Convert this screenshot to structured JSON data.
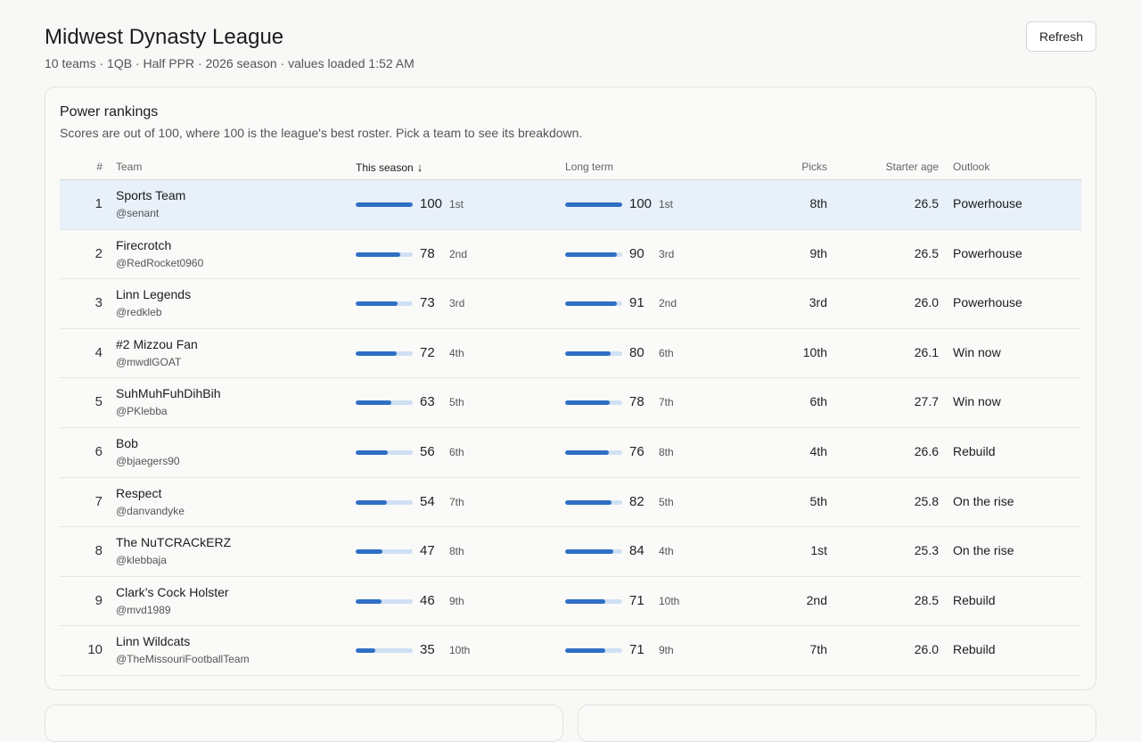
{
  "header": {
    "title": "Midwest Dynasty League",
    "subtitle": "10 teams · 1QB · Half PPR · 2026 season · values loaded 1:52 AM",
    "refresh_label": "Refresh"
  },
  "rankings": {
    "title": "Power rankings",
    "description": "Scores are out of 100, where 100 is the league's best roster. Pick a team to see its breakdown.",
    "columns": {
      "rank": "#",
      "team": "Team",
      "this_season": "This season",
      "sort_arrow": "↓",
      "long_term": "Long term",
      "picks": "Picks",
      "starter_age": "Starter age",
      "outlook": "Outlook"
    },
    "selected_index": 0,
    "rows": [
      {
        "rank": "1",
        "name": "Sports Team",
        "handle": "@senant",
        "season_score": 100,
        "season_place": "1st",
        "long_score": 100,
        "long_place": "1st",
        "picks": "8th",
        "age": "26.5",
        "outlook": "Powerhouse"
      },
      {
        "rank": "2",
        "name": "Firecrotch",
        "handle": "@RedRocket0960",
        "season_score": 78,
        "season_place": "2nd",
        "long_score": 90,
        "long_place": "3rd",
        "picks": "9th",
        "age": "26.5",
        "outlook": "Powerhouse"
      },
      {
        "rank": "3",
        "name": "Linn Legends",
        "handle": "@redkleb",
        "season_score": 73,
        "season_place": "3rd",
        "long_score": 91,
        "long_place": "2nd",
        "picks": "3rd",
        "age": "26.0",
        "outlook": "Powerhouse"
      },
      {
        "rank": "4",
        "name": "#2 Mizzou Fan",
        "handle": "@mwdlGOAT",
        "season_score": 72,
        "season_place": "4th",
        "long_score": 80,
        "long_place": "6th",
        "picks": "10th",
        "age": "26.1",
        "outlook": "Win now"
      },
      {
        "rank": "5",
        "name": "SuhMuhFuhDihBih",
        "handle": "@PKlebba",
        "season_score": 63,
        "season_place": "5th",
        "long_score": 78,
        "long_place": "7th",
        "picks": "6th",
        "age": "27.7",
        "outlook": "Win now"
      },
      {
        "rank": "6",
        "name": "Bob",
        "handle": "@bjaegers90",
        "season_score": 56,
        "season_place": "6th",
        "long_score": 76,
        "long_place": "8th",
        "picks": "4th",
        "age": "26.6",
        "outlook": "Rebuild"
      },
      {
        "rank": "7",
        "name": "Respect",
        "handle": "@danvandyke",
        "season_score": 54,
        "season_place": "7th",
        "long_score": 82,
        "long_place": "5th",
        "picks": "5th",
        "age": "25.8",
        "outlook": "On the rise"
      },
      {
        "rank": "8",
        "name": "The NuTCRACkERZ",
        "handle": "@klebbaja",
        "season_score": 47,
        "season_place": "8th",
        "long_score": 84,
        "long_place": "4th",
        "picks": "1st",
        "age": "25.3",
        "outlook": "On the rise"
      },
      {
        "rank": "9",
        "name": "Clark’s Cock Holster",
        "handle": "@mvd1989",
        "season_score": 46,
        "season_place": "9th",
        "long_score": 71,
        "long_place": "10th",
        "picks": "2nd",
        "age": "28.5",
        "outlook": "Rebuild"
      },
      {
        "rank": "10",
        "name": "Linn Wildcats",
        "handle": "@TheMissouriFootballTeam",
        "season_score": 35,
        "season_place": "10th",
        "long_score": 71,
        "long_place": "9th",
        "picks": "7th",
        "age": "26.0",
        "outlook": "Rebuild"
      }
    ]
  },
  "colors": {
    "bar_fill": "#2f6fc4",
    "bar_track": "#cfe0f4",
    "selected_row": "#e8f0fa"
  }
}
